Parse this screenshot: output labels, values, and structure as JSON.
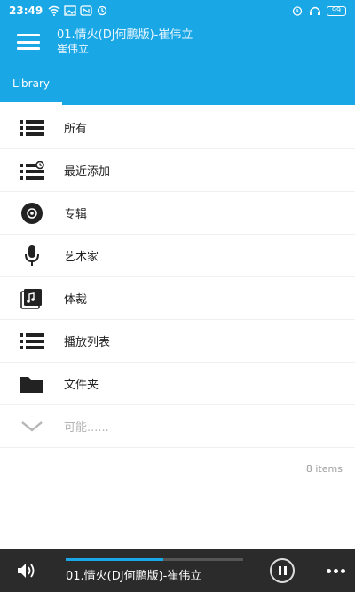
{
  "status_bar": {
    "time": "23:49",
    "battery": "99"
  },
  "app_bar": {
    "menu_icon": "hamburger-menu-icon",
    "title": "01.情火(DJ何鹏版)-崔伟立",
    "subtitle": "崔伟立"
  },
  "tabs": [
    {
      "label": "Library",
      "selected": true
    }
  ],
  "library": {
    "items": [
      {
        "label": "所有",
        "icon": "list-icon"
      },
      {
        "label": "最近添加",
        "icon": "recent-list-icon"
      },
      {
        "label": "专辑",
        "icon": "album-disc-icon"
      },
      {
        "label": "艺术家",
        "icon": "microphone-icon"
      },
      {
        "label": "体裁",
        "icon": "music-note-icon"
      },
      {
        "label": "播放列表",
        "icon": "playlist-icon"
      },
      {
        "label": "文件夹",
        "icon": "folder-icon"
      }
    ],
    "more": {
      "label": "可能......",
      "icon": "chevron-down-icon"
    },
    "count_text": "8 items"
  },
  "player": {
    "track_title": "01.情火(DJ何鹏版)-崔伟立",
    "progress": 0.55,
    "accent": "#1aa7e6"
  },
  "colors": {
    "primary": "#1aa7e6",
    "player_bg": "#2b2b2b"
  }
}
